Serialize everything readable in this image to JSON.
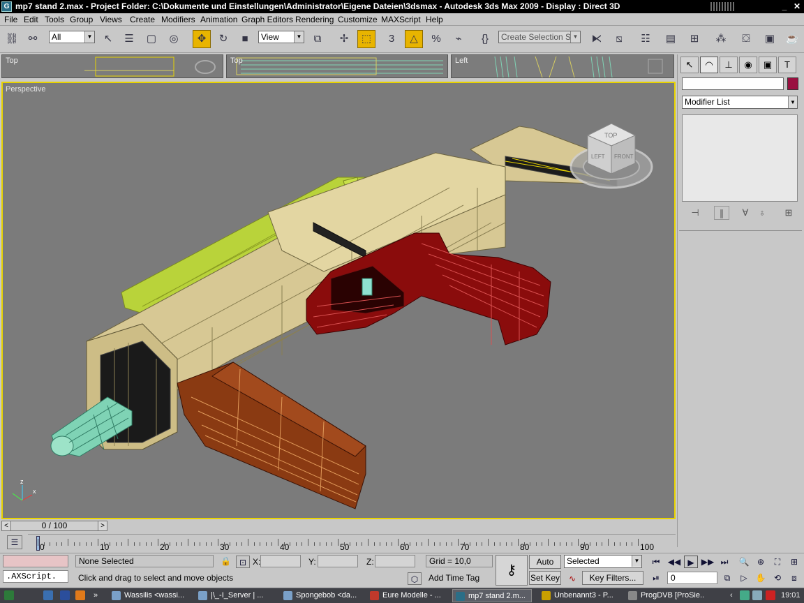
{
  "window": {
    "title": "mp7 stand 2.max     - Project Folder: C:\\Dokumente und Einstellungen\\Administrator\\Eigene Dateien\\3dsmax     - Autodesk 3ds Max  2009      - Display : Direct 3D",
    "app_icon": "G",
    "minimize": "_",
    "close": "✕"
  },
  "menu": [
    "File",
    "Edit",
    "Tools",
    "Group",
    "Views",
    "Create",
    "Modifiers",
    "Animation",
    "Graph Editors",
    "Rendering",
    "Customize",
    "MAXScript",
    "Help"
  ],
  "toolbar": {
    "selection_filter": "All",
    "reference_coord": "View",
    "named_selection": "Create Selection Set",
    "snap_label": "3",
    "icons": [
      "link-icon",
      "unlink-icon",
      "select-icon",
      "select-by-name-icon",
      "rect-select-icon",
      "window-crossing-icon",
      "move-icon",
      "rotate-icon",
      "scale-icon",
      "pivot-icon",
      "manipulate-icon",
      "keyboard-shortcut-icon",
      "snap-icon",
      "angle-snap-icon",
      "percent-snap-icon",
      "spinner-snap-icon",
      "edit-named-sets-icon",
      "mirror-icon",
      "align-icon",
      "layer-icon",
      "curve-editor-icon",
      "schematic-icon",
      "material-editor-icon",
      "render-setup-icon",
      "rendered-frame-icon",
      "render-icon"
    ]
  },
  "viewports": {
    "mini": [
      "Top",
      "Top",
      "Left"
    ],
    "main_label": "Perspective",
    "viewcube": {
      "top": "TOP",
      "left": "LEFT",
      "front": "FRONT"
    },
    "axes": {
      "x": "x",
      "z": "z"
    }
  },
  "command_panel": {
    "modifier_list": "Modifier List",
    "object_color": "#9a1040",
    "tabs": [
      "create-icon",
      "modify-icon",
      "hierarchy-icon",
      "motion-icon",
      "display-icon",
      "utilities-icon"
    ]
  },
  "timeline": {
    "frame_display": "0 / 100",
    "ticks": [
      "0",
      "10",
      "20",
      "30",
      "40",
      "50",
      "60",
      "70",
      "80",
      "90",
      "100"
    ]
  },
  "status": {
    "selection": "None Selected",
    "prompt": "Click and drag to select and move objects",
    "maxscript": ".AXScript.",
    "x_label": "X:",
    "y_label": "Y:",
    "z_label": "Z:",
    "grid": "Grid = 10,0",
    "add_time_tag": "Add Time Tag",
    "auto_key": "Auto Key",
    "set_key": "Set Key",
    "key_mode": "Selected",
    "key_filters": "Key Filters...",
    "current_frame": "0"
  },
  "taskbar": {
    "tasks": [
      "Wassilis <wassi...",
      "|\\_-I_Server | ...",
      "Spongebob <da...",
      "Eure Modelle - ...",
      "mp7 stand 2.m...",
      "Unbenannt3 - P...",
      "ProgDVB [ProSie..."
    ],
    "active_task": 4,
    "clock": "19:01"
  },
  "colors": {
    "viewport_bg": "#7b7b7b",
    "active_viewport_border": "#e8d300",
    "body_tan": "#d7c894",
    "grip_red": "#8a0c0c",
    "mag_orange": "#8a3a12",
    "rail_green": "#b9d33a",
    "barrel_teal": "#7fd3b5"
  }
}
